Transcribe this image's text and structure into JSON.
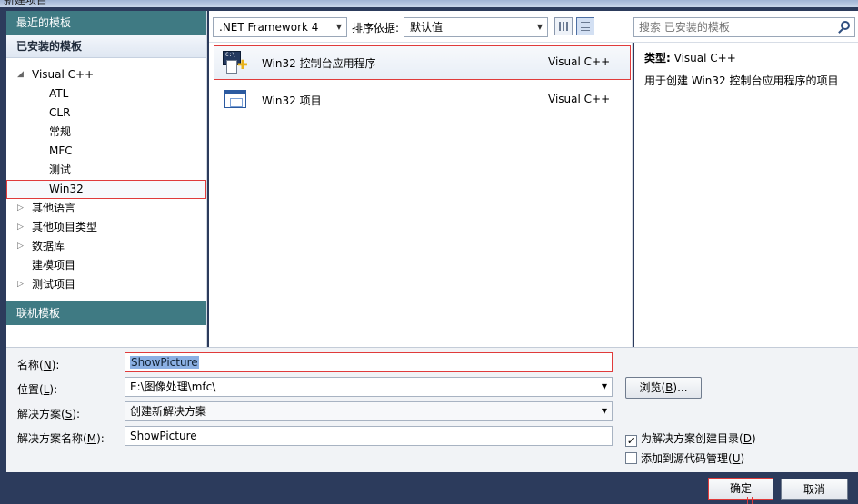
{
  "window": {
    "title": "新建项目"
  },
  "left": {
    "recent_header": "最近的模板",
    "installed_header": "已安装的模板",
    "tree": [
      {
        "label": "Visual C++",
        "level": 0,
        "arrow": "◢"
      },
      {
        "label": "ATL",
        "level": 1
      },
      {
        "label": "CLR",
        "level": 1
      },
      {
        "label": "常规",
        "level": 1
      },
      {
        "label": "MFC",
        "level": 1
      },
      {
        "label": "测试",
        "level": 1
      },
      {
        "label": "Win32",
        "level": 1,
        "selected": true
      },
      {
        "label": "其他语言",
        "level": 0,
        "arrow": "▷"
      },
      {
        "label": "其他项目类型",
        "level": 0,
        "arrow": "▷"
      },
      {
        "label": "数据库",
        "level": 0,
        "arrow": "▷"
      },
      {
        "label": "建模项目",
        "level": 0
      },
      {
        "label": "测试项目",
        "level": 0,
        "arrow": "▷"
      }
    ],
    "online_header": "联机模板"
  },
  "toolbar": {
    "framework": ".NET Framework 4",
    "sort_label": "排序依据:",
    "sort_value": "默认值",
    "search_placeholder": "搜索 已安装的模板"
  },
  "templates": [
    {
      "name": "Win32 控制台应用程序",
      "lang": "Visual C++",
      "icon": "console-app-icon",
      "selected": true
    },
    {
      "name": "Win32 项目",
      "lang": "Visual C++",
      "icon": "win32-project-icon"
    }
  ],
  "info": {
    "type_label": "类型:",
    "type_value": "Visual C++",
    "description": "用于创建 Win32 控制台应用程序的项目"
  },
  "form": {
    "name_label": "名称",
    "name_key": "N",
    "name_value": "ShowPicture",
    "location_label": "位置",
    "location_key": "L",
    "location_value": "E:\\图像处理\\mfc\\",
    "solution_label": "解决方案",
    "solution_key": "S",
    "solution_value": "创建新解决方案",
    "solution_name_label": "解决方案名称",
    "solution_name_key": "M",
    "solution_name_value": "ShowPicture",
    "browse_label": "浏览",
    "browse_key": "B",
    "create_dir_label": "为解决方案创建目录",
    "create_dir_key": "D",
    "create_dir_checked": true,
    "source_control_label": "添加到源代码管理",
    "source_control_key": "U",
    "source_control_checked": false
  },
  "buttons": {
    "ok": "确定",
    "cancel": "取消"
  },
  "colors": {
    "accent_header": "#3f7a83",
    "highlight": "#e03b3b",
    "frame": "#2c3b5c"
  }
}
